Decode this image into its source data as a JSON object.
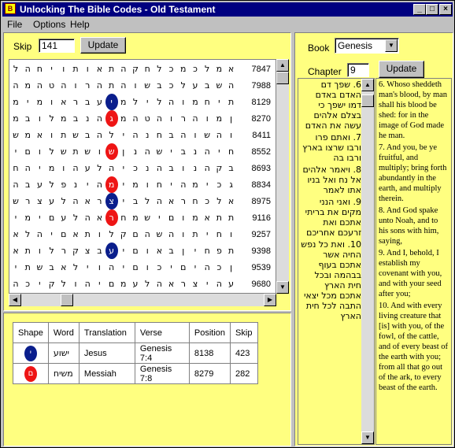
{
  "window": {
    "title": "Unlocking The Bible Codes - Old Testament",
    "minimize": "_",
    "maximize": "□",
    "close": "×"
  },
  "menu": {
    "file": "File",
    "options": "Options",
    "help": "Help"
  },
  "skip": {
    "label": "Skip",
    "value": "141",
    "update": "Update"
  },
  "grid": {
    "rows": [
      {
        "num": "7847",
        "letters": [
          "ל",
          "ה",
          "ח",
          "י",
          "ו",
          "ת",
          "ו",
          "א",
          "ת",
          "ה",
          "ק",
          "ח",
          "ל",
          "כ",
          "מ",
          "כ",
          "ל",
          "מ",
          "א"
        ]
      },
      {
        "num": "7988",
        "letters": [
          "ה",
          "מ",
          "ה",
          "ט",
          "ה",
          "ו",
          "ר",
          "ה",
          "ת",
          "ה",
          "ו",
          "ש",
          "ב",
          "כ",
          "ל",
          "ע",
          "ב",
          "ש",
          "ה"
        ]
      },
      {
        "num": "8129",
        "letters": [
          "מ",
          "י",
          "מ",
          "ו",
          "א",
          "ר",
          "ב",
          "ע",
          "י",
          "מ",
          "ל",
          "י",
          "ל",
          "ה",
          "ו",
          "מ",
          "ח",
          "י",
          "ת"
        ]
      },
      {
        "num": "8270",
        "letters": [
          "מ",
          "ב",
          "ו",
          "ל",
          "מ",
          "ב",
          "נ",
          "ה",
          "ג",
          "מ",
          "ה",
          "ט",
          "ה",
          "ו",
          "ר",
          "ה",
          "ו",
          "מ",
          "ן"
        ]
      },
      {
        "num": "8411",
        "letters": [
          "ש",
          "מ",
          "א",
          "ו",
          "ת",
          "ש",
          "ב",
          "ה",
          "ל",
          "י",
          "ה",
          "נ",
          "ח",
          "ב",
          "ה",
          "ו",
          "ש",
          "ה",
          "ו"
        ]
      },
      {
        "num": "8552",
        "letters": [
          "י",
          "ם",
          "ו",
          "ל",
          "ש",
          "ת",
          "ש",
          "ו",
          "ש",
          "ן",
          "נ",
          "ה",
          "ש",
          "י",
          "ב",
          "נ",
          "ה",
          "י",
          "ח"
        ]
      },
      {
        "num": "8693",
        "letters": [
          "ח",
          "ה",
          "י",
          "מ",
          "ו",
          "ה",
          "ע",
          "ל",
          "ה",
          "י",
          "כ",
          "נ",
          "ה",
          "ב",
          "ו",
          "נ",
          "ה",
          "ק",
          "ב"
        ]
      },
      {
        "num": "8834",
        "letters": [
          "ה",
          "ב",
          "ע",
          "ל",
          "פ",
          "נ",
          "י",
          "ה",
          "מ",
          "י",
          "מ",
          "ו",
          "ח",
          "י",
          "ה",
          "מ",
          "י",
          "כ",
          "ג"
        ]
      },
      {
        "num": "8975",
        "letters": [
          "ש",
          "ר",
          "צ",
          "ע",
          "ל",
          "ה",
          "א",
          "ר",
          "צ",
          "י",
          "ב",
          "ל",
          "ה",
          "א",
          "ר",
          "ח",
          "כ",
          "ל",
          "א"
        ]
      },
      {
        "num": "9116",
        "letters": [
          "י",
          "מ",
          "י",
          "ם",
          "ע",
          "ל",
          "ה",
          "א",
          "ר",
          "ח",
          "מ",
          "ש",
          "י",
          "ם",
          "ו",
          "מ",
          "א",
          "ת",
          "ת"
        ]
      },
      {
        "num": "9257",
        "letters": [
          "א",
          "ל",
          "ה",
          "י",
          "ם",
          "א",
          "ת",
          "ו",
          "ל",
          "ק",
          "ם",
          "ה",
          "ש",
          "ה",
          "ו",
          "ת",
          "י",
          "ח",
          "ו"
        ]
      },
      {
        "num": "9398",
        "letters": [
          "א",
          "ת",
          "ו",
          "ל",
          "ר",
          "ק",
          "צ",
          "ב",
          "ע",
          "י",
          "ם",
          "ו",
          "א",
          "ב",
          "ן",
          "י",
          "ח",
          "פ",
          "ת"
        ]
      },
      {
        "num": "9539",
        "letters": [
          "י",
          "ת",
          "ש",
          "ב",
          "א",
          "ל",
          "י",
          "ו",
          "ה",
          "י",
          "ם",
          "ו",
          "כ",
          "י",
          "ם",
          "י",
          "ה",
          "כ",
          "ן"
        ]
      },
      {
        "num": "9680",
        "letters": [
          "ה",
          "כ",
          "י",
          "ק",
          "ל",
          "ו",
          "ה",
          "י",
          "ם",
          "מ",
          "ע",
          "ל",
          "ה",
          "א",
          "ר",
          "צ",
          "י",
          "ה",
          "ע"
        ]
      }
    ]
  },
  "results": {
    "headers": [
      "Shape",
      "Word",
      "Translation",
      "Verse",
      "Position",
      "Skip"
    ],
    "rows": [
      {
        "shape": "י",
        "shape_color": "#0a1e8c",
        "word": "ישוע",
        "translation": "Jesus",
        "verse": "Genesis 7:4",
        "position": "8138",
        "skip": "423"
      },
      {
        "shape": "ם",
        "shape_color": "#ee1515",
        "word": "משיח",
        "translation": "Messiah",
        "verse": "Genesis 7:8",
        "position": "8279",
        "skip": "282"
      }
    ]
  },
  "book": {
    "label": "Book",
    "value": "Genesis"
  },
  "chapter": {
    "label": "Chapter",
    "value": "9",
    "update": "Update"
  },
  "hebrew_text": [
    "6. שפך דם האדם באדם דמו ישפך כי בצלם אלהים עשה את האדם",
    "7. ואתם פרו ורבו שרצו בארץ ורבו בה",
    "8. ויאמר אלהים אל נח ואל בניו אתו לאמר",
    "9. ואני הנני מקים את בריתי אתכם ואת זרעכם אחריכם",
    "10. ואת כל נפש החיה אשר אתכם בעוף בבהמה ובכל חית הארץ אתכם מכל יצאי התבה לכל חית הארץ"
  ],
  "english_text": [
    "6. Whoso sheddeth man's blood, by man shall his blood be shed: for in the image of God made he man.",
    "7. And you, be ye fruitful, and multiply; bring forth abundantly in the earth, and multiply therein.",
    "8. And God spake unto Noah, and to his sons with him, saying,",
    "9. And I, behold, I establish my covenant with you, and with your seed after you;",
    "10. And with every living creature that [is] with you, of the fowl, of the cattle, and of every beast of the earth with you; from all that go out of the ark, to every beast of the earth."
  ]
}
